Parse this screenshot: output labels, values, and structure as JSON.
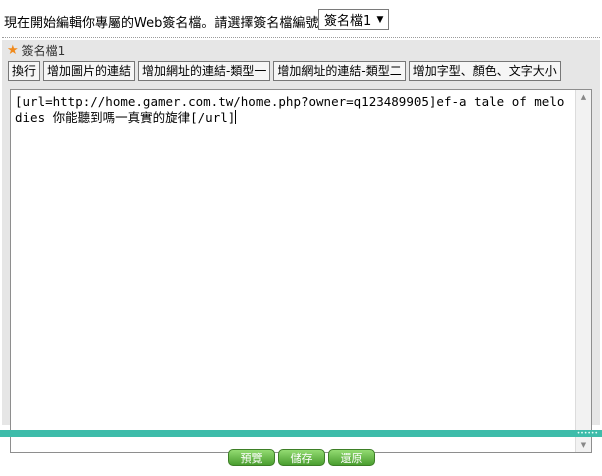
{
  "header": {
    "prompt": "現在開始編輯你專屬的Web簽名檔。請選擇簽名檔編號",
    "selected_signature": "簽名檔1"
  },
  "panel": {
    "title": "簽名檔1",
    "title_icon": "star-icon"
  },
  "toolbar": {
    "newline": "換行",
    "add_image_link": "增加圖片的連結",
    "add_url_type1": "增加網址的連結-類型一",
    "add_url_type2": "增加網址的連結-類型二",
    "add_font_style": "增加字型、顏色、文字大小"
  },
  "editor": {
    "text": "[url=http://home.gamer.com.tw/home.php?owner=q123489905]ef-a tale of melodies 你能聽到嗎一真實的旋律[/url]"
  },
  "actions": {
    "preview": "預覽",
    "save": "儲存",
    "restore": "還原"
  },
  "colors": {
    "accent_teal": "#3ebcaa",
    "button_green": "#4a9e2f",
    "star_orange": "#f08a1c"
  }
}
